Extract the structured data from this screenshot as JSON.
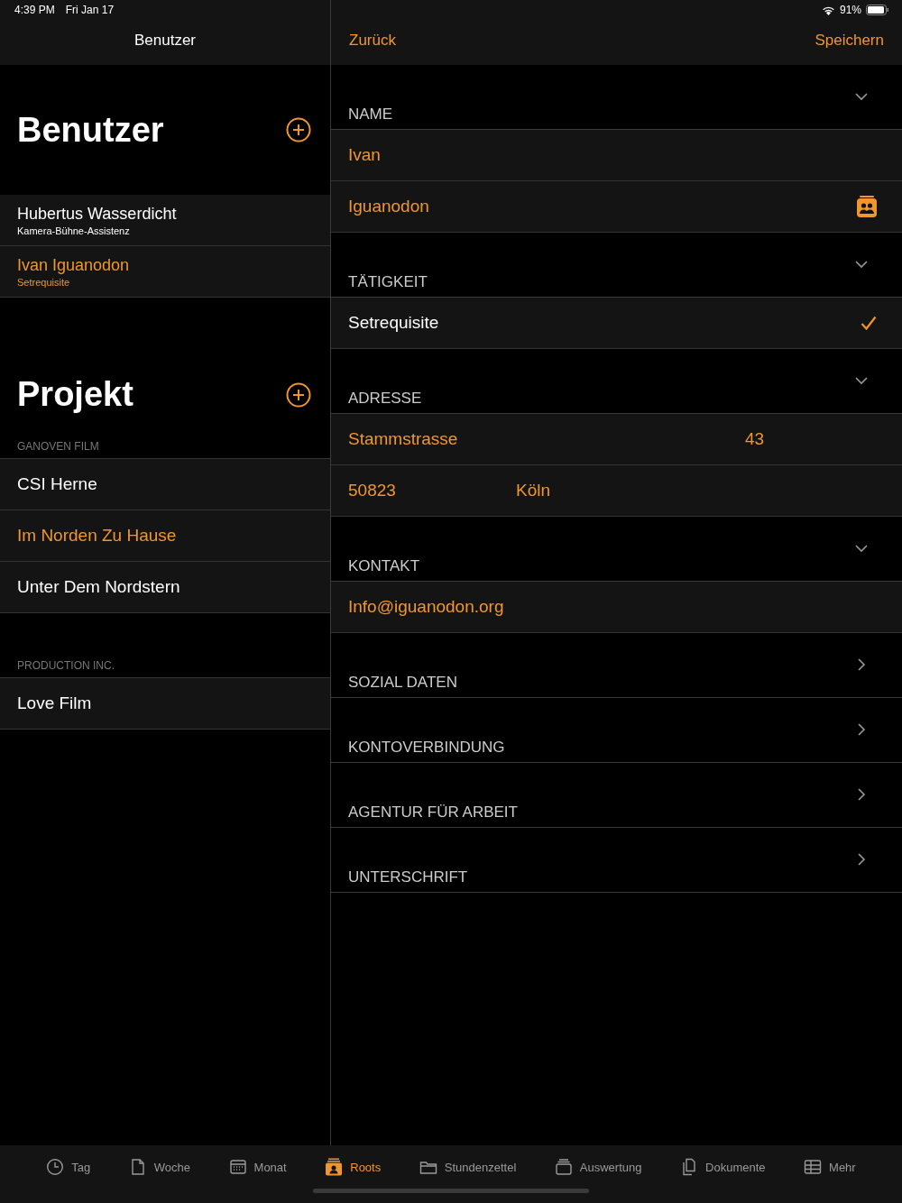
{
  "status_bar": {
    "time": "4:39 PM",
    "date": "Fri Jan 17",
    "battery": "91%"
  },
  "master": {
    "nav_title": "Benutzer",
    "users": {
      "title": "Benutzer",
      "items": [
        {
          "name": "Hubertus Wasserdicht",
          "role": "Kamera-Bühne-Assistenz",
          "selected": false
        },
        {
          "name": "Ivan Iguanodon",
          "role": "Setrequisite",
          "selected": true
        }
      ]
    },
    "projects": {
      "title": "Projekt",
      "groups": [
        {
          "header": "GANOVEN FILM",
          "items": [
            {
              "name": "CSI Herne",
              "selected": false
            },
            {
              "name": "Im Norden Zu Hause",
              "selected": true
            },
            {
              "name": "Unter Dem Nordstern",
              "selected": false
            }
          ]
        },
        {
          "header": "PRODUCTION INC.",
          "items": [
            {
              "name": "Love Film",
              "selected": false
            }
          ]
        }
      ]
    }
  },
  "detail": {
    "back": "Zurück",
    "save": "Speichern",
    "sections": [
      {
        "title": "NAME",
        "expanded": true,
        "rows": [
          {
            "kind": "field",
            "value": "Ivan"
          },
          {
            "kind": "contact-field",
            "value": "Iguanodon"
          }
        ]
      },
      {
        "title": "TÄTIGKEIT",
        "expanded": true,
        "rows": [
          {
            "kind": "choice",
            "value": "Setrequisite",
            "checked": true
          }
        ]
      },
      {
        "title": "ADRESSE",
        "expanded": true,
        "rows": [
          {
            "kind": "pair",
            "value": "Stammstrasse",
            "value_2": "43"
          },
          {
            "kind": "pair",
            "value": "50823",
            "value_2": "Köln"
          }
        ]
      },
      {
        "title": "KONTAKT",
        "expanded": true,
        "rows": [
          {
            "kind": "field",
            "value": "Info@iguanodon.org"
          }
        ]
      },
      {
        "title": "SOZIAL DATEN",
        "expanded": false
      },
      {
        "title": "KONTOVERBINDUNG",
        "expanded": false
      },
      {
        "title": "AGENTUR FÜR ARBEIT",
        "expanded": false
      },
      {
        "title": "UNTERSCHRIFT",
        "expanded": false
      }
    ]
  },
  "tab_bar": [
    {
      "label": "Tag",
      "selected": false
    },
    {
      "label": "Woche",
      "selected": false
    },
    {
      "label": "Monat",
      "selected": false
    },
    {
      "label": "Roots",
      "selected": true
    },
    {
      "label": "Stundenzettel",
      "selected": false
    },
    {
      "label": "Auswertung",
      "selected": false
    },
    {
      "label": "Dokumente",
      "selected": false
    },
    {
      "label": "Mehr",
      "selected": false
    }
  ]
}
